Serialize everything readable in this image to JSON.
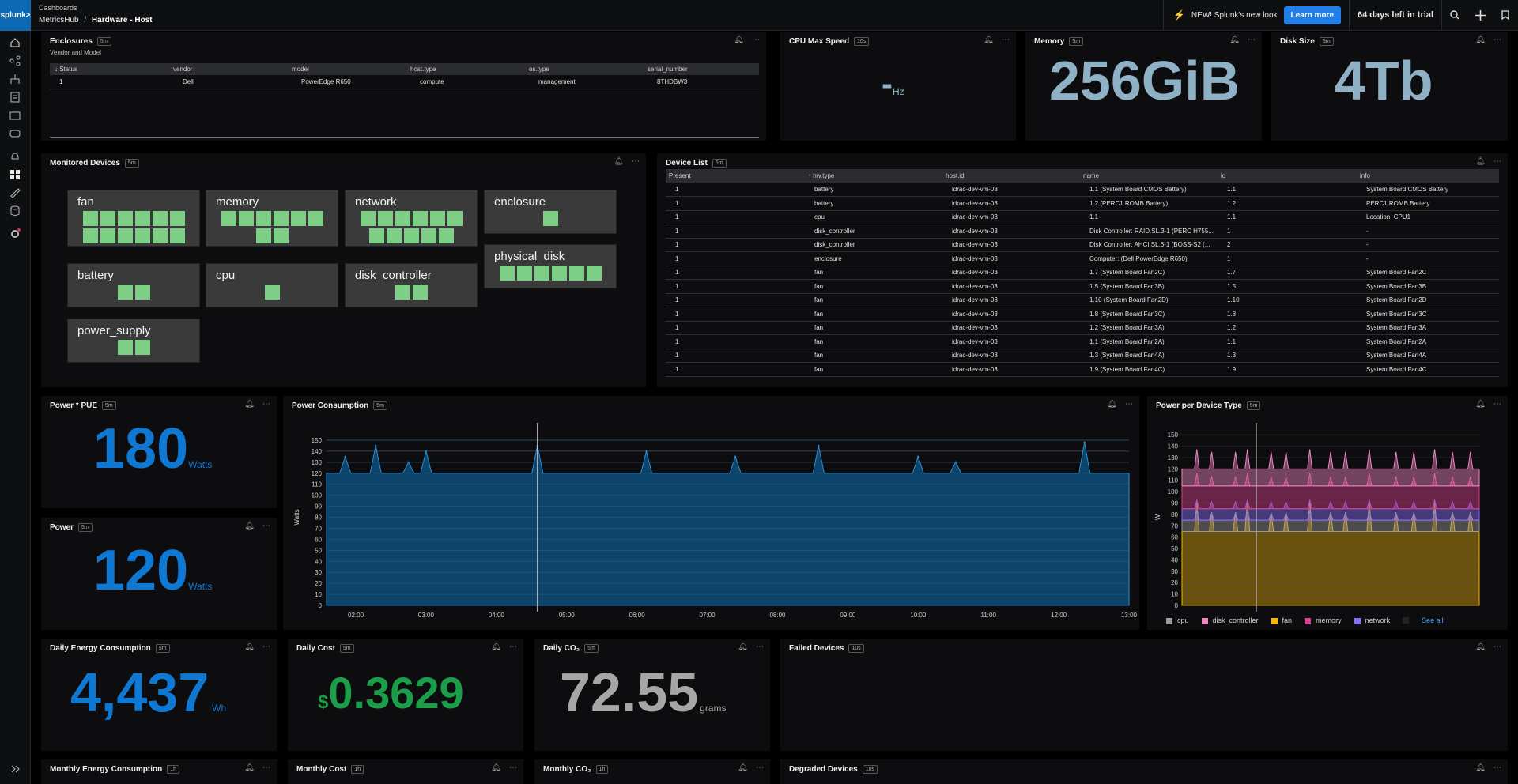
{
  "app": {
    "logo": "splunk>"
  },
  "header": {
    "breadcrumb_top": "Dashboards",
    "crumb_app": "MetricsHub",
    "crumb_sep": "/",
    "crumb_page": "Hardware - Host",
    "new_text": "NEW! Splunk's new look",
    "learn_more": "Learn more",
    "trial": "64 days left in trial"
  },
  "enclosures": {
    "title": "Enclosures",
    "badge": "5m",
    "subtitle": "Vendor and Model",
    "columns": [
      "↓ Status",
      "vendor",
      "model",
      "host.type",
      "os.type",
      "serial_number"
    ],
    "rows": [
      [
        "1",
        "Dell",
        "PowerEdge R650",
        "compute",
        "management",
        "8THDBW3"
      ]
    ]
  },
  "cpu": {
    "title": "CPU Max Speed",
    "badge": "10s",
    "value": "-",
    "unit": "Hz"
  },
  "memory": {
    "title": "Memory",
    "badge": "5m",
    "value": "256GiB"
  },
  "disk": {
    "title": "Disk Size",
    "badge": "5m",
    "value": "4Tb"
  },
  "monitored": {
    "title": "Monitored Devices",
    "badge": "5m",
    "tiles": [
      {
        "label": "fan",
        "count": 12
      },
      {
        "label": "memory",
        "count": 8
      },
      {
        "label": "network",
        "count": 11
      },
      {
        "label": "enclosure",
        "count": 1
      },
      {
        "label": "battery",
        "count": 2
      },
      {
        "label": "cpu",
        "count": 1
      },
      {
        "label": "disk_controller",
        "count": 2
      },
      {
        "label": "physical_disk",
        "count": 6
      },
      {
        "label": "power_supply",
        "count": 2
      }
    ]
  },
  "devices": {
    "title": "Device List",
    "badge": "5m",
    "columns": [
      "Present",
      "↑ hw.type",
      "host.id",
      "name",
      "id",
      "info"
    ],
    "rows": [
      [
        "1",
        "battery",
        "idrac-dev-vm-03",
        "1.1 (System Board CMOS Battery)",
        "1.1",
        "System Board CMOS Battery"
      ],
      [
        "1",
        "battery",
        "idrac-dev-vm-03",
        "1.2 (PERC1 ROMB Battery)",
        "1.2",
        "PERC1 ROMB Battery"
      ],
      [
        "1",
        "cpu",
        "idrac-dev-vm-03",
        "1.1",
        "1.1",
        "Location: CPU1"
      ],
      [
        "1",
        "disk_controller",
        "idrac-dev-vm-03",
        "Disk Controller: RAID.SL.3-1 (PERC H755...",
        "1",
        "-"
      ],
      [
        "1",
        "disk_controller",
        "idrac-dev-vm-03",
        "Disk Controller: AHCI.SL.6-1 (BOSS-S2 (...",
        "2",
        "-"
      ],
      [
        "1",
        "enclosure",
        "idrac-dev-vm-03",
        "Computer: (Dell PowerEdge R650)",
        "1",
        "-"
      ],
      [
        "1",
        "fan",
        "idrac-dev-vm-03",
        "1.7 (System Board Fan2C)",
        "1.7",
        "System Board Fan2C"
      ],
      [
        "1",
        "fan",
        "idrac-dev-vm-03",
        "1.5 (System Board Fan3B)",
        "1.5",
        "System Board Fan3B"
      ],
      [
        "1",
        "fan",
        "idrac-dev-vm-03",
        "1.10 (System Board Fan2D)",
        "1.10",
        "System Board Fan2D"
      ],
      [
        "1",
        "fan",
        "idrac-dev-vm-03",
        "1.8 (System Board Fan3C)",
        "1.8",
        "System Board Fan3C"
      ],
      [
        "1",
        "fan",
        "idrac-dev-vm-03",
        "1.2 (System Board Fan3A)",
        "1.2",
        "System Board Fan3A"
      ],
      [
        "1",
        "fan",
        "idrac-dev-vm-03",
        "1.1 (System Board Fan2A)",
        "1.1",
        "System Board Fan2A"
      ],
      [
        "1",
        "fan",
        "idrac-dev-vm-03",
        "1.3 (System Board Fan4A)",
        "1.3",
        "System Board Fan4A"
      ],
      [
        "1",
        "fan",
        "idrac-dev-vm-03",
        "1.9 (System Board Fan4C)",
        "1.9",
        "System Board Fan4C"
      ]
    ]
  },
  "pue": {
    "title": "Power * PUE",
    "badge": "5m",
    "value": "180",
    "unit": "Watts"
  },
  "power": {
    "title": "Power",
    "badge": "5m",
    "value": "120",
    "unit": "Watts"
  },
  "consumption": {
    "title": "Power Consumption",
    "badge": "5m"
  },
  "per_type": {
    "title": "Power per Device Type",
    "badge": "5m",
    "see_all": "See all"
  },
  "daily_energy": {
    "title": "Daily Energy Consumption",
    "badge": "5m",
    "value": "4,437",
    "unit": "Wh"
  },
  "daily_cost": {
    "title": "Daily Cost",
    "badge": "5m",
    "currency": "$",
    "value": "0.3629"
  },
  "daily_co2": {
    "title": "Daily CO₂",
    "badge": "5m",
    "value": "72.55",
    "unit": "grams"
  },
  "failed": {
    "title": "Failed Devices",
    "badge": "10s"
  },
  "monthly_energy": {
    "title": "Monthly Energy Consumption",
    "badge": "1h"
  },
  "monthly_cost": {
    "title": "Monthly Cost",
    "badge": "1h"
  },
  "monthly_co2": {
    "title": "Monthly CO₂",
    "badge": "1h"
  },
  "degraded": {
    "title": "Degraded Devices",
    "badge": "10s"
  },
  "colors": {
    "blue": "#0f78d2",
    "green": "#1a9e4a",
    "slate": "#8fb1c6",
    "grey": "#a6a6a6",
    "tile": "#7ccf85"
  },
  "chart_data": [
    {
      "type": "area",
      "title": "Power Consumption",
      "ylabel": "Watts",
      "ylim": [
        0,
        160
      ],
      "yticks": [
        0,
        10,
        20,
        30,
        40,
        50,
        60,
        70,
        80,
        90,
        100,
        110,
        120,
        130,
        140,
        150
      ],
      "xticks": [
        "02:00",
        "03:00",
        "04:00",
        "05:00",
        "06:00",
        "07:00",
        "08:00",
        "09:00",
        "10:00",
        "11:00",
        "12:00",
        "13:00"
      ],
      "baseline": 120,
      "spikes": [
        {
          "x": "01:51",
          "y": 135
        },
        {
          "x": "02:17",
          "y": 145
        },
        {
          "x": "02:45",
          "y": 130
        },
        {
          "x": "03:00",
          "y": 140
        },
        {
          "x": "04:35",
          "y": 145
        },
        {
          "x": "06:08",
          "y": 140
        },
        {
          "x": "07:24",
          "y": 135
        },
        {
          "x": "08:35",
          "y": 145
        },
        {
          "x": "10:00",
          "y": 135
        },
        {
          "x": "10:32",
          "y": 130
        },
        {
          "x": "12:22",
          "y": 148
        }
      ]
    },
    {
      "type": "area",
      "title": "Power per Device Type",
      "ylabel": "W",
      "ylim": [
        0,
        155
      ],
      "yticks": [
        0,
        10,
        20,
        30,
        40,
        50,
        60,
        70,
        80,
        90,
        100,
        110,
        120,
        130,
        140,
        150
      ],
      "stacked": true,
      "series": [
        {
          "name": "cpu",
          "color": "#9a9a9a",
          "value": 10
        },
        {
          "name": "disk_controller",
          "color": "#f086c2",
          "value": 15
        },
        {
          "name": "fan",
          "color": "#f5b70a",
          "value": 65
        },
        {
          "name": "memory",
          "color": "#d9418f",
          "value": 20
        },
        {
          "name": "network",
          "color": "#8a6cff",
          "value": 10
        }
      ]
    }
  ]
}
